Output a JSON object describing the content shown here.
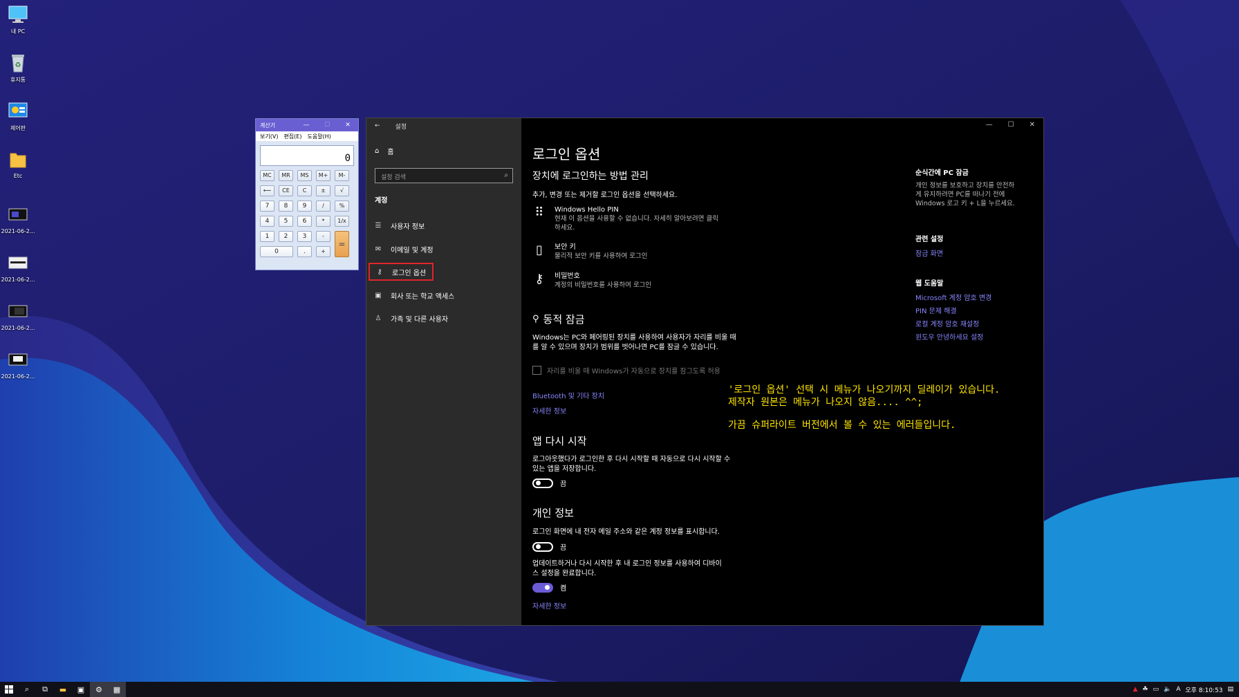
{
  "desktop": {
    "icons": [
      {
        "label": "내 PC",
        "icon": "monitor-icon"
      },
      {
        "label": "휴지통",
        "icon": "recycle-bin-icon"
      },
      {
        "label": "제어판",
        "icon": "control-panel-icon"
      },
      {
        "label": "Etc",
        "icon": "folder-icon"
      },
      {
        "label": "2021-06-2...",
        "icon": "screenshot-file-icon"
      },
      {
        "label": "2021-06-2...",
        "icon": "screenshot-file-icon"
      },
      {
        "label": "2021-06-2...",
        "icon": "screenshot-file-icon"
      },
      {
        "label": "2021-06-2...",
        "icon": "screenshot-file-icon"
      }
    ]
  },
  "calculator": {
    "title": "계산기",
    "menu": [
      "보기(V)",
      "편집(E)",
      "도움말(H)"
    ],
    "display": "0",
    "buttons": {
      "mc": "MC",
      "mr": "MR",
      "ms": "MS",
      "mplus": "M+",
      "mminus": "M-",
      "back": "⟵",
      "ce": "CE",
      "c": "C",
      "pm": "±",
      "sqrt": "√",
      "n7": "7",
      "n8": "8",
      "n9": "9",
      "div": "/",
      "pct": "%",
      "n4": "4",
      "n5": "5",
      "n6": "6",
      "mul": "*",
      "inv": "1/x",
      "n1": "1",
      "n2": "2",
      "n3": "3",
      "sub": "-",
      "eq": "=",
      "n0": "0",
      "dot": ".",
      "add": "+"
    }
  },
  "settings": {
    "window_title": "설정",
    "nav": {
      "home": "홈",
      "search_placeholder": "설정 검색",
      "section": "계정",
      "items": [
        {
          "label": "사용자 정보",
          "icon": "user-info-icon"
        },
        {
          "label": "이메일 및 계정",
          "icon": "mail-icon"
        },
        {
          "label": "로그인 옵션",
          "icon": "key-icon",
          "selected": true
        },
        {
          "label": "회사 또는 학교 액세스",
          "icon": "briefcase-icon"
        },
        {
          "label": "가족 및 다른 사용자",
          "icon": "person-icon"
        }
      ]
    },
    "main": {
      "title": "로그인 옵션",
      "manage_heading": "장치에 로그인하는 방법 관리",
      "manage_desc": "추가, 변경 또는 제거할 로그인 옵션을 선택하세요.",
      "options": [
        {
          "title": "Windows Hello PIN",
          "desc1": "현재 이 옵션을 사용할 수 없습니다. 자세히 알아보려면 클릭",
          "desc2": "하세요.",
          "icon": "pin-keypad-icon"
        },
        {
          "title": "보안 키",
          "desc1": "물리적 보안 키를 사용하여 로그인",
          "desc2": "",
          "icon": "usb-key-icon"
        },
        {
          "title": "비밀번호",
          "desc1": "계정의 비밀번호를 사용하여 로그인",
          "desc2": "",
          "icon": "key-icon"
        }
      ],
      "dynamic_lock": {
        "heading": "동적 잠금",
        "desc1": "Windows는 PC와 페어링된 장치를 사용하여 사용자가 자리를 비울 때",
        "desc2": "를 알 수 있으며 장치가 범위를 벗어나면 PC를 잠글 수 있습니다.",
        "checkbox": "자리를 비울 때 Windows가 자동으로 장치를 잠그도록 허용",
        "link_bluetooth": "Bluetooth 및 기타 장치",
        "link_more": "자세한 정보"
      },
      "restart_apps": {
        "heading": "앱 다시 시작",
        "desc1": "로그아웃했다가 로그인한 후 다시 시작할 때 자동으로 다시 시작할 수",
        "desc2": "있는 앱을 저장합니다.",
        "toggle_state": "끔",
        "toggle_on": false
      },
      "privacy": {
        "heading": "개인 정보",
        "desc_email": "로그인 화면에 내 전자 메일 주소와 같은 계정 정보를 표시합니다.",
        "toggle1_state": "끔",
        "toggle1_on": false,
        "desc_update1": "업데이트하거나 다시 시작한 후 내 로그인 정보를 사용하여 디바이",
        "desc_update2": "스 설정을 완료합니다.",
        "toggle2_state": "켬",
        "toggle2_on": true,
        "link_more": "자세한 정보"
      },
      "annotation": {
        "line1": "'로그인 옵션' 선택 시 메뉴가 나오기까지 딜레이가 있습니다.",
        "line2": "제작자 원본은 메뉴가 나오지 않음.... ^^;",
        "line3": "가끔 슈퍼라이트 버전에서 볼 수 있는 에러들입니다."
      },
      "sidebar": {
        "lock_heading": "순식간에 PC 잠금",
        "lock_desc1": "개인 정보를 보호하고 장치를 안전하",
        "lock_desc2": "게 유지하려면 PC를 떠나기 전에",
        "lock_desc3": "Windows 로고 키 + L을 누르세요.",
        "related_heading": "관련 설정",
        "related_link": "잠금 화면",
        "help_heading": "웹 도움말",
        "help_links": [
          "Microsoft 계정 암호 변경",
          "PIN 문제 해결",
          "로컬 계정 암호 재설정",
          "윈도우 안녕하세요 설정"
        ]
      }
    }
  },
  "taskbar": {
    "clock": "오후 8:10:53",
    "ime": "A"
  },
  "colors": {
    "accent": "#6b5bd6",
    "link": "#8a87ff",
    "annotation": "#ffe500",
    "selection_border": "#e0242d"
  }
}
